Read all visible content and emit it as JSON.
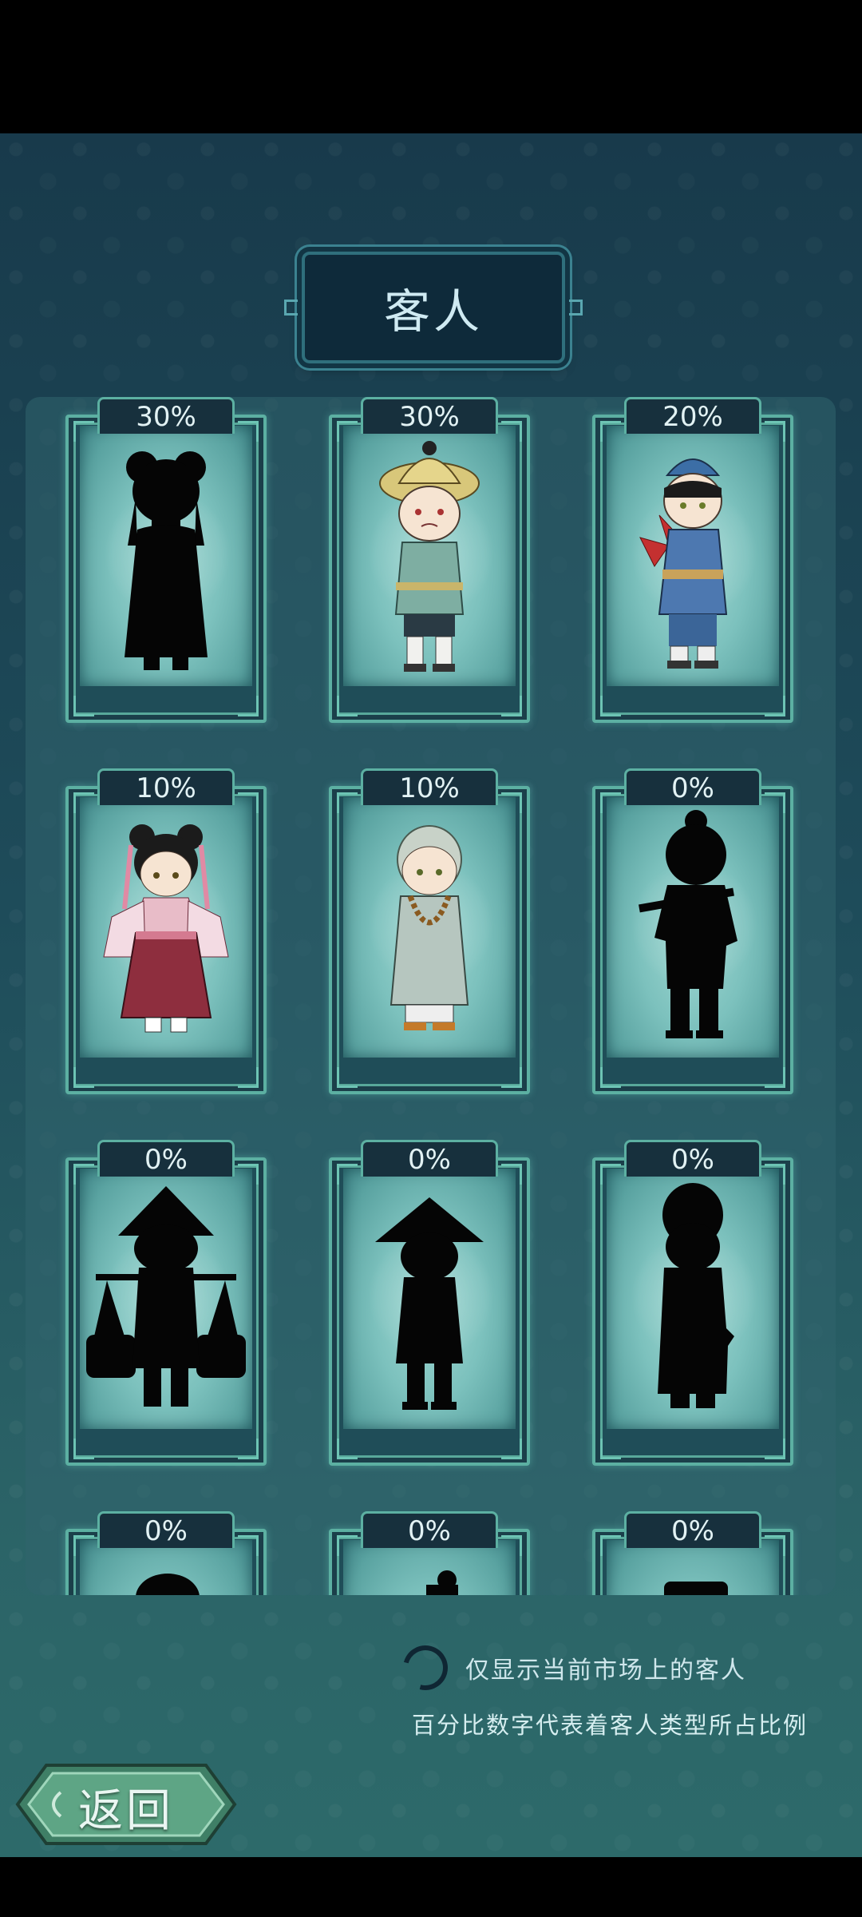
{
  "screen": {
    "title": "客人"
  },
  "customers": [
    {
      "percent": "30%",
      "state": "locked",
      "figure": "girl-silhouette"
    },
    {
      "percent": "30%",
      "state": "unlocked",
      "figure": "farmer-straw-hat"
    },
    {
      "percent": "20%",
      "state": "unlocked",
      "figure": "boy-blue-pinwheel"
    },
    {
      "percent": "10%",
      "state": "unlocked",
      "figure": "girl-red-hanfu"
    },
    {
      "percent": "10%",
      "state": "unlocked",
      "figure": "young-monk"
    },
    {
      "percent": "0%",
      "state": "locked",
      "figure": "man-with-pole-silhouette"
    },
    {
      "percent": "0%",
      "state": "locked",
      "figure": "peddler-with-baskets-silhouette"
    },
    {
      "percent": "0%",
      "state": "locked",
      "figure": "man-conical-hat-silhouette"
    },
    {
      "percent": "0%",
      "state": "locked",
      "figure": "scholar-silhouette"
    },
    {
      "percent": "0%",
      "state": "locked",
      "figure": "partial-silhouette"
    },
    {
      "percent": "0%",
      "state": "locked",
      "figure": "partial-silhouette"
    },
    {
      "percent": "0%",
      "state": "locked",
      "figure": "partial-silhouette"
    }
  ],
  "footer": {
    "filter_label": "仅显示当前市场上的客人",
    "note": "百分比数字代表着客人类型所占比例",
    "filter_icon": "loading-ring-icon"
  },
  "back_button": {
    "label": "返回"
  },
  "colors": {
    "background_top": "#183a4b",
    "background_bottom": "#2d6a6a",
    "card_border": "#5cb0a2",
    "card_inner": "#7cc1bd",
    "silhouette": "#050505"
  }
}
